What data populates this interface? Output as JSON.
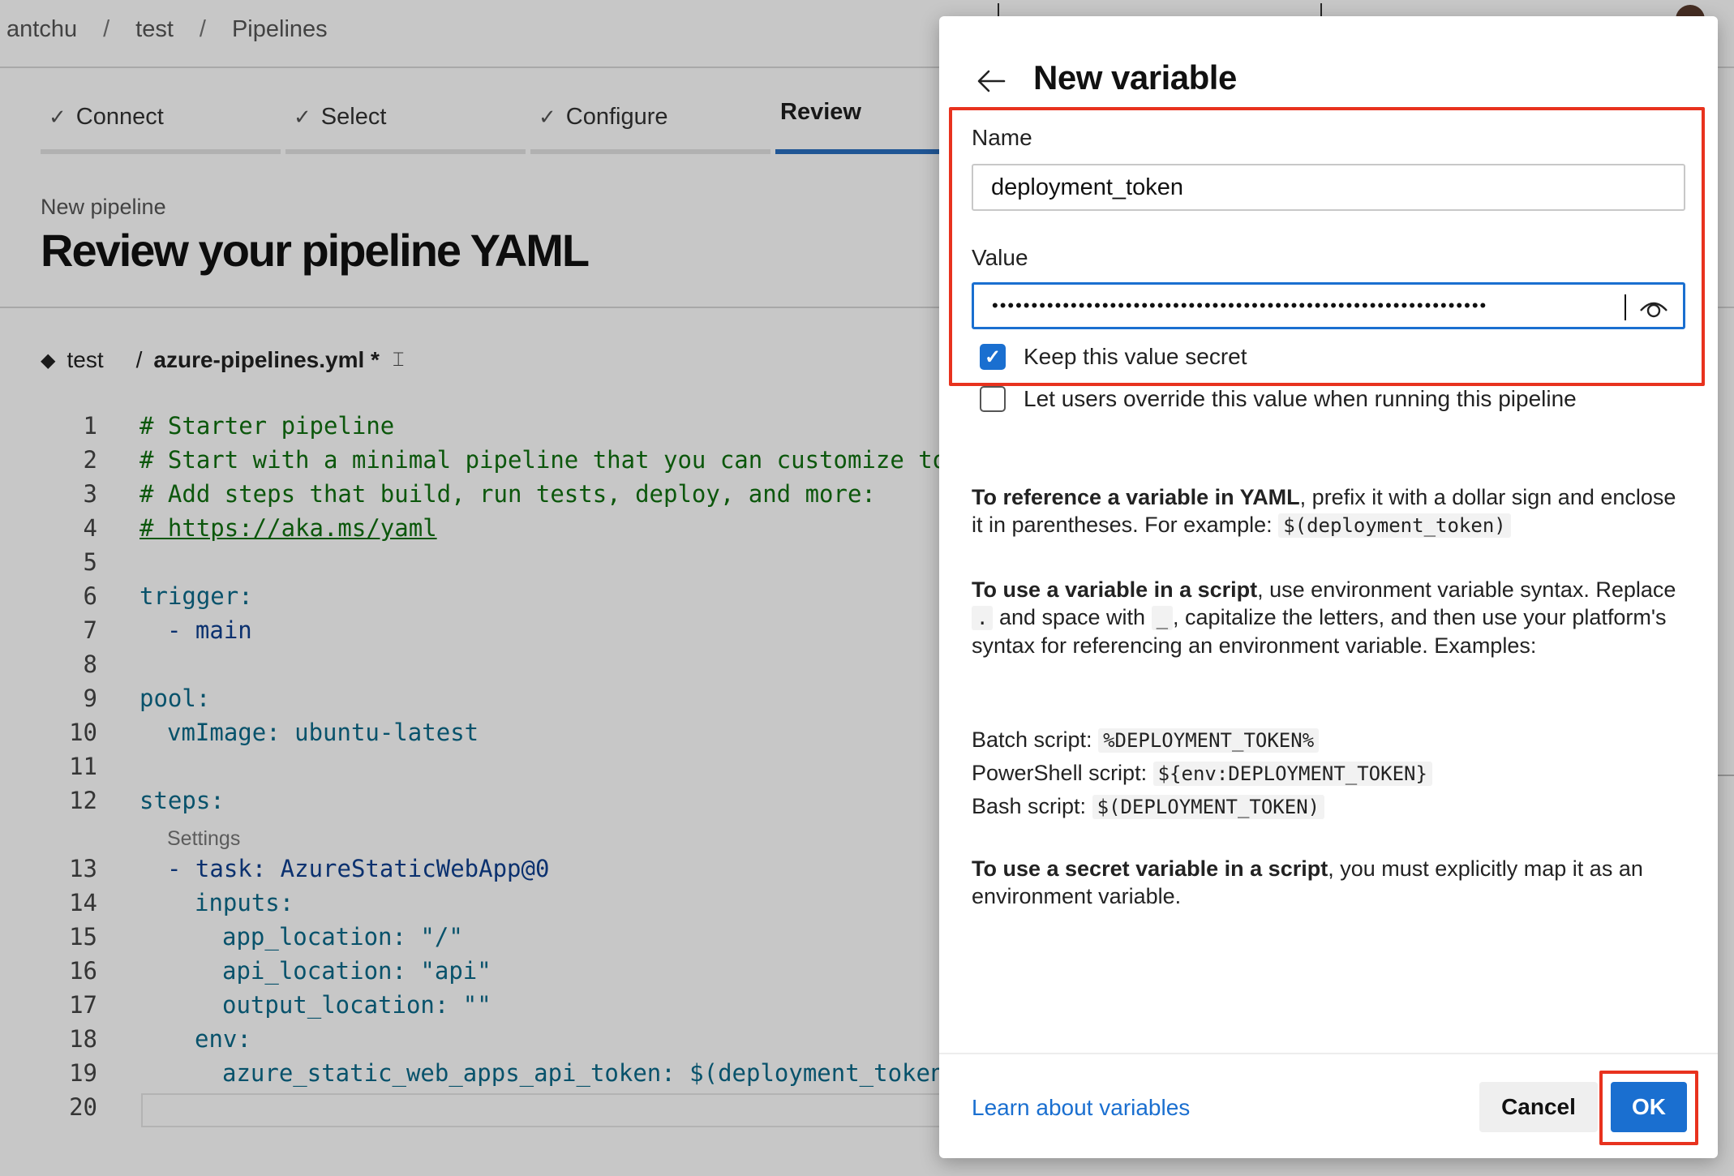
{
  "breadcrumb": [
    "antchu",
    "test",
    "Pipelines"
  ],
  "breadcrumb_separator": "/",
  "stepper": {
    "steps": [
      {
        "label": "Connect",
        "state": "done"
      },
      {
        "label": "Select",
        "state": "done"
      },
      {
        "label": "Configure",
        "state": "done"
      },
      {
        "label": "Review",
        "state": "active"
      }
    ]
  },
  "header": {
    "subtitle": "New pipeline",
    "title": "Review your pipeline YAML"
  },
  "file": {
    "repo": "test",
    "separator": "/",
    "filename": "azure-pipelines.yml *"
  },
  "editor": {
    "settings_lens": "Settings",
    "lines": [
      {
        "n": "1",
        "text": "# Starter pipeline"
      },
      {
        "n": "2",
        "text": "# Start with a minimal pipeline that you can customize to b"
      },
      {
        "n": "3",
        "text": "# Add steps that build, run tests, deploy, and more:"
      },
      {
        "n": "4",
        "text": "# https://aka.ms/yaml"
      },
      {
        "n": "5",
        "text": ""
      },
      {
        "n": "6",
        "text": "trigger:"
      },
      {
        "n": "7",
        "text": "- main"
      },
      {
        "n": "8",
        "text": ""
      },
      {
        "n": "9",
        "text": "pool:"
      },
      {
        "n": "10",
        "text": "vmImage: ubuntu-latest"
      },
      {
        "n": "11",
        "text": ""
      },
      {
        "n": "12",
        "text": "steps:"
      },
      {
        "n": "13",
        "text": "- task: AzureStaticWebApp@0"
      },
      {
        "n": "14",
        "text": "inputs:"
      },
      {
        "n": "15",
        "text": "app_location: \"/\""
      },
      {
        "n": "16",
        "text": "api_location: \"api\""
      },
      {
        "n": "17",
        "text": "output_location: \"\""
      },
      {
        "n": "18",
        "text": "env:"
      },
      {
        "n": "19",
        "text": "azure_static_web_apps_api_token: $(deployment_token)"
      },
      {
        "n": "20",
        "text": ""
      }
    ]
  },
  "dialog": {
    "title": "New variable",
    "name_label": "Name",
    "name_value": "deployment_token",
    "value_label": "Value",
    "value_masked": "•••••••••••••••••••••••••••••••••••••••••••••••••••••••••••••••",
    "keep_secret_label": "Keep this value secret",
    "keep_secret_checked": true,
    "override_label": "Let users override this value when running this pipeline",
    "override_checked": false,
    "help": {
      "ref_bold": "To reference a variable in YAML",
      "ref_text": ", prefix it with a dollar sign and enclose it in parentheses. For example: ",
      "ref_example": "$(deployment_token)",
      "script_bold": "To use a variable in a script",
      "script_text1": ", use environment variable syntax. Replace ",
      "script_dot": ".",
      "script_text2": " and space with ",
      "script_underscore": "_",
      "script_text3": ", capitalize the letters, and then use your platform's syntax for referencing an environment variable. Examples:",
      "batch_label": "Batch script: ",
      "batch_value": "%DEPLOYMENT_TOKEN%",
      "ps_label": "PowerShell script: ",
      "ps_value": "${env:DEPLOYMENT_TOKEN}",
      "bash_label": "Bash script: ",
      "bash_value": "$(DEPLOYMENT_TOKEN)",
      "secret_bold": "To use a secret variable in a script",
      "secret_text": ", you must explicitly map it as an environment variable."
    },
    "learn_link": "Learn about variables",
    "cancel_label": "Cancel",
    "ok_label": "OK"
  },
  "colors": {
    "accent": "#1a6fd0",
    "highlight_box": "#e8321e",
    "comment": "#107010",
    "yaml_key": "#0b6a8a",
    "yaml_value": "#0f3f8f"
  },
  "icons": {
    "back": "arrow-left-icon",
    "eye": "eye-icon",
    "check": "checkmark-icon",
    "repo": "git-diamond-icon",
    "edit": "rename-icon"
  }
}
